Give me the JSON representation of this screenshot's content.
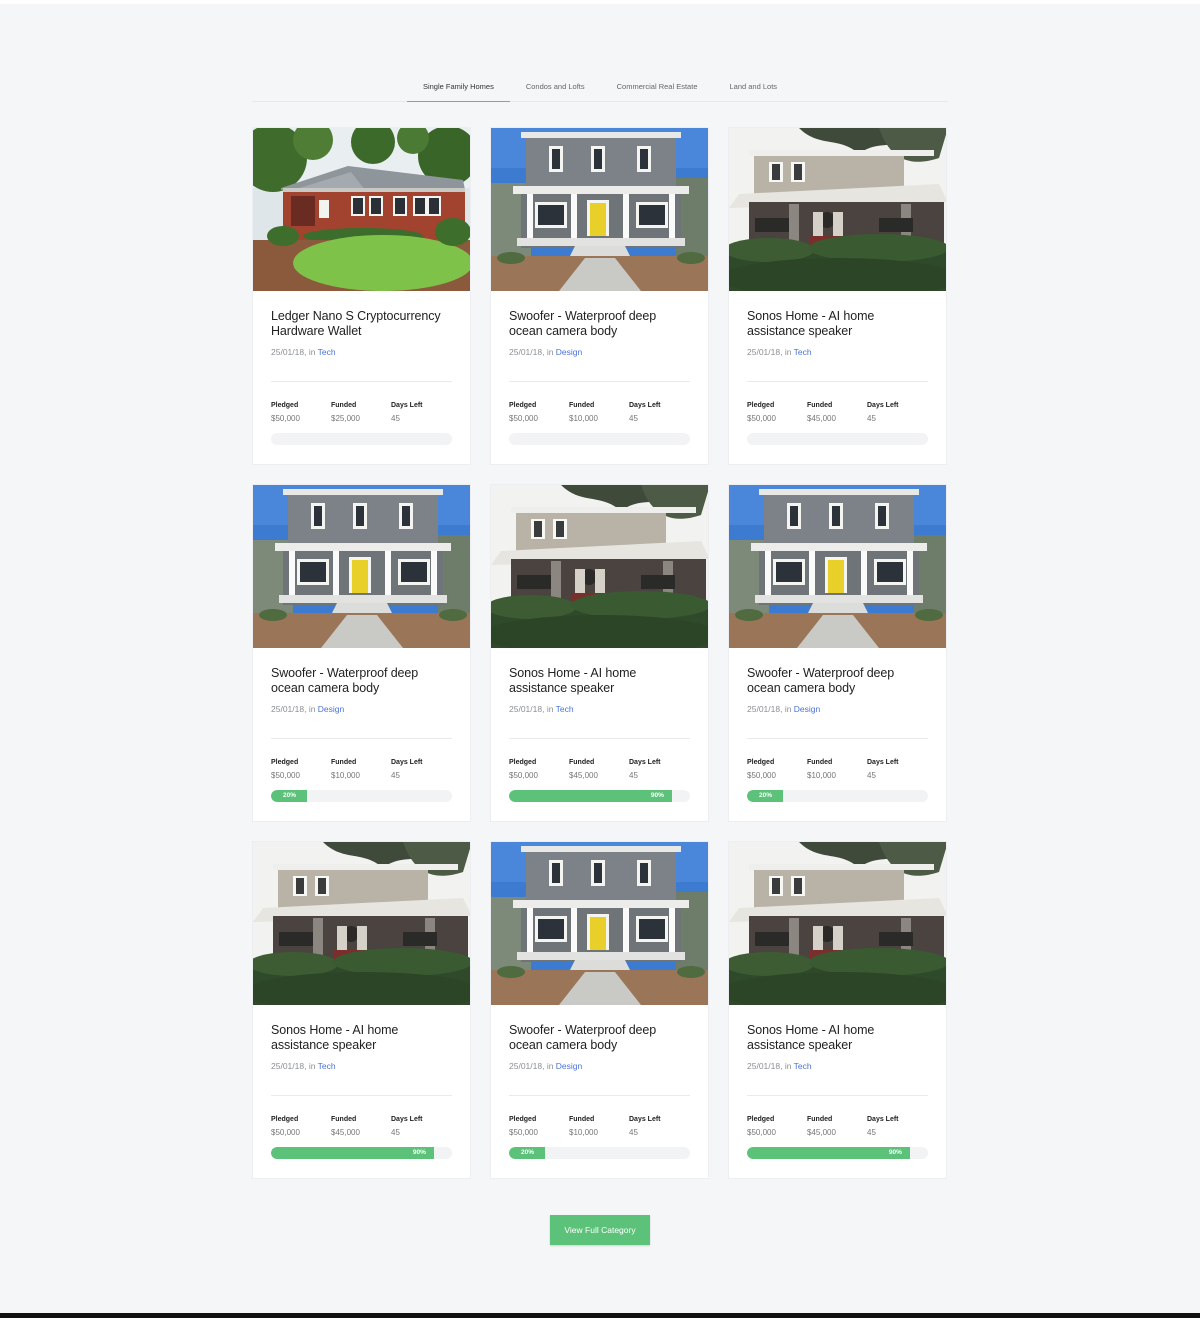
{
  "tabs": [
    {
      "label": "Single Family Homes",
      "active": true
    },
    {
      "label": "Condos and Lofts",
      "active": false
    },
    {
      "label": "Commercial Real Estate",
      "active": false
    },
    {
      "label": "Land and Lots",
      "active": false
    }
  ],
  "stat_labels": {
    "pledged": "Pledged",
    "funded": "Funded",
    "days_left": "Days Left"
  },
  "meta_separator": ", in ",
  "cards": [
    {
      "image": "brick-house-photo",
      "title": "Ledger Nano S Cryptocurrency Hardware Wallet",
      "date": "25/01/18",
      "category": "Tech",
      "pledged": "$50,000",
      "funded": "$25,000",
      "days_left": "45",
      "progress": 0,
      "progress_label": ""
    },
    {
      "image": "gray-house-photo",
      "title": "Swoofer - Waterproof deep ocean camera body",
      "date": "25/01/18",
      "category": "Design",
      "pledged": "$50,000",
      "funded": "$10,000",
      "days_left": "45",
      "progress": 0,
      "progress_label": ""
    },
    {
      "image": "craftsman-house-photo",
      "title": "Sonos Home - AI home assistance speaker",
      "date": "25/01/18",
      "category": "Tech",
      "pledged": "$50,000",
      "funded": "$45,000",
      "days_left": "45",
      "progress": 0,
      "progress_label": ""
    },
    {
      "image": "gray-house-photo",
      "title": "Swoofer - Waterproof deep ocean camera body",
      "date": "25/01/18",
      "category": "Design",
      "pledged": "$50,000",
      "funded": "$10,000",
      "days_left": "45",
      "progress": 20,
      "progress_label": "20%"
    },
    {
      "image": "craftsman-house-photo",
      "title": "Sonos Home - AI home assistance speaker",
      "date": "25/01/18",
      "category": "Tech",
      "pledged": "$50,000",
      "funded": "$45,000",
      "days_left": "45",
      "progress": 90,
      "progress_label": "90%"
    },
    {
      "image": "gray-house-photo",
      "title": "Swoofer - Waterproof deep ocean camera body",
      "date": "25/01/18",
      "category": "Design",
      "pledged": "$50,000",
      "funded": "$10,000",
      "days_left": "45",
      "progress": 20,
      "progress_label": "20%"
    },
    {
      "image": "craftsman-house-photo",
      "title": "Sonos Home - AI home assistance speaker",
      "date": "25/01/18",
      "category": "Tech",
      "pledged": "$50,000",
      "funded": "$45,000",
      "days_left": "45",
      "progress": 90,
      "progress_label": "90%"
    },
    {
      "image": "gray-house-photo",
      "title": "Swoofer - Waterproof deep ocean camera body",
      "date": "25/01/18",
      "category": "Design",
      "pledged": "$50,000",
      "funded": "$10,000",
      "days_left": "45",
      "progress": 20,
      "progress_label": "20%"
    },
    {
      "image": "craftsman-house-photo",
      "title": "Sonos Home - AI home assistance speaker",
      "date": "25/01/18",
      "category": "Tech",
      "pledged": "$50,000",
      "funded": "$45,000",
      "days_left": "45",
      "progress": 90,
      "progress_label": "90%"
    }
  ],
  "cta_label": "View Full Category",
  "colors": {
    "accent": "#5cc27a",
    "link": "#4a73d8",
    "background": "#f5f6f8"
  }
}
